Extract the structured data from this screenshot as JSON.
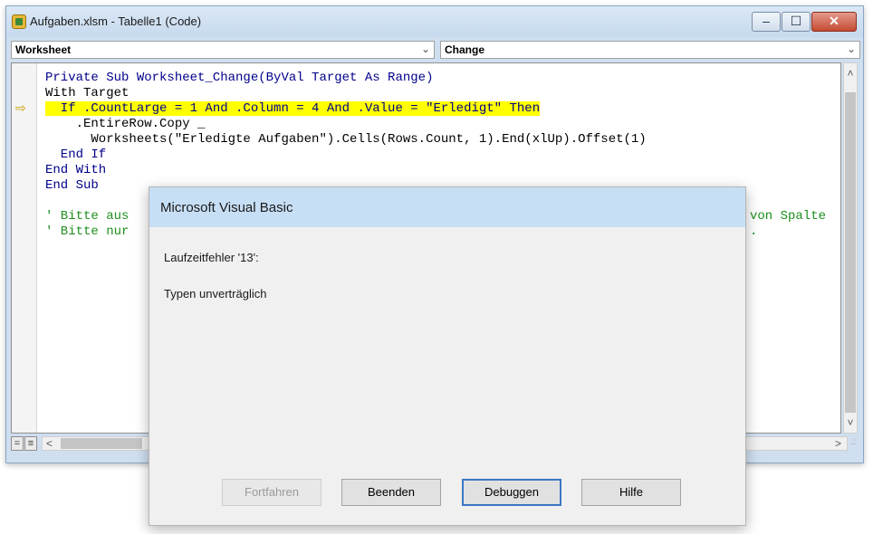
{
  "window": {
    "title": "Aufgaben.xlsm - Tabelle1 (Code)",
    "minimize": "–",
    "maximize": "☐",
    "close": "✕"
  },
  "dropdowns": {
    "object": "Worksheet",
    "procedure": "Change",
    "arrow": "⌄"
  },
  "code": {
    "line1": "Private Sub Worksheet_Change(ByVal Target As Range)",
    "line2": "With Target",
    "line3": "  If .CountLarge = 1 And .Column = 4 And .Value = \"Erledigt\" Then",
    "line4": "    .EntireRow.Copy _",
    "line5": "      Worksheets(\"Erledigte Aufgaben\").Cells(Rows.Count, 1).End(xlUp).Offset(1)",
    "line6": "  End If",
    "line7": "End With",
    "line8": "End Sub",
    "line9": "' Bitte aus",
    "line9_tail": "von Spalte",
    "line10": "' Bitte nur",
    "line10_tail": ".",
    "exec_arrow": "⇨"
  },
  "scroll": {
    "up": "˄",
    "down": "˅",
    "left": "<",
    "right": ">",
    "view1": "=",
    "view2": "≡",
    "grip": ".:"
  },
  "dialog": {
    "title": "Microsoft Visual Basic",
    "message1": "Laufzeitfehler '13':",
    "message2": "Typen unverträglich",
    "buttons": {
      "continue": "Fortfahren",
      "end": "Beenden",
      "debug": "Debuggen",
      "help": "Hilfe"
    }
  },
  "colors": {
    "highlight": "#ffff00",
    "keyword": "#00008b",
    "comment": "#1e8f1e",
    "dialog_title_bg": "#c7dff5"
  }
}
